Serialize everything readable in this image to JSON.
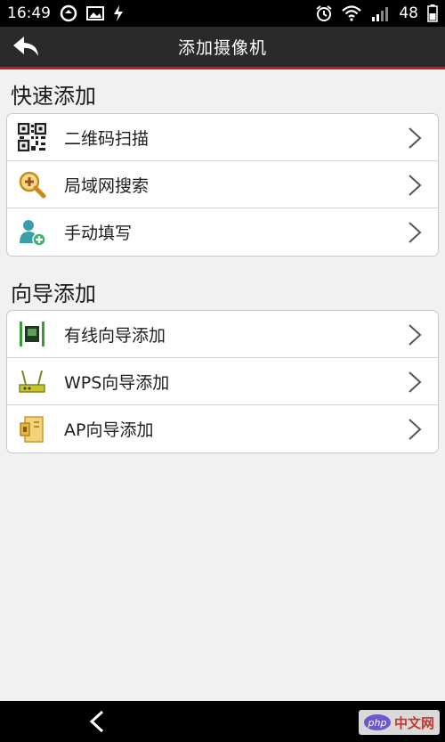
{
  "status_bar": {
    "time": "16:49",
    "battery": "48",
    "icons_left": [
      "sync-icon",
      "image-icon",
      "charging-bolt-icon"
    ],
    "icons_right": [
      "alarm-icon",
      "wifi-icon",
      "signal-icon"
    ]
  },
  "header": {
    "title": "添加摄像机",
    "back_icon": "back-arrow-icon"
  },
  "quick_add": {
    "section_title": "快速添加",
    "items": [
      {
        "label": "二维码扫描",
        "icon": "qrcode-icon"
      },
      {
        "label": "局域网搜索",
        "icon": "search-plus-icon"
      },
      {
        "label": "手动填写",
        "icon": "add-user-icon"
      }
    ]
  },
  "guide_add": {
    "section_title": "向导添加",
    "items": [
      {
        "label": "有线向导添加",
        "icon": "wired-icon"
      },
      {
        "label": "WPS向导添加",
        "icon": "router-icon"
      },
      {
        "label": "AP向导添加",
        "icon": "ap-icon"
      }
    ]
  },
  "watermark": {
    "brand": "php",
    "text": "中文网"
  },
  "colors": {
    "title_bar": "#2a2a2a",
    "accent_red": "#c81b1b",
    "background": "#f1f1f1"
  }
}
